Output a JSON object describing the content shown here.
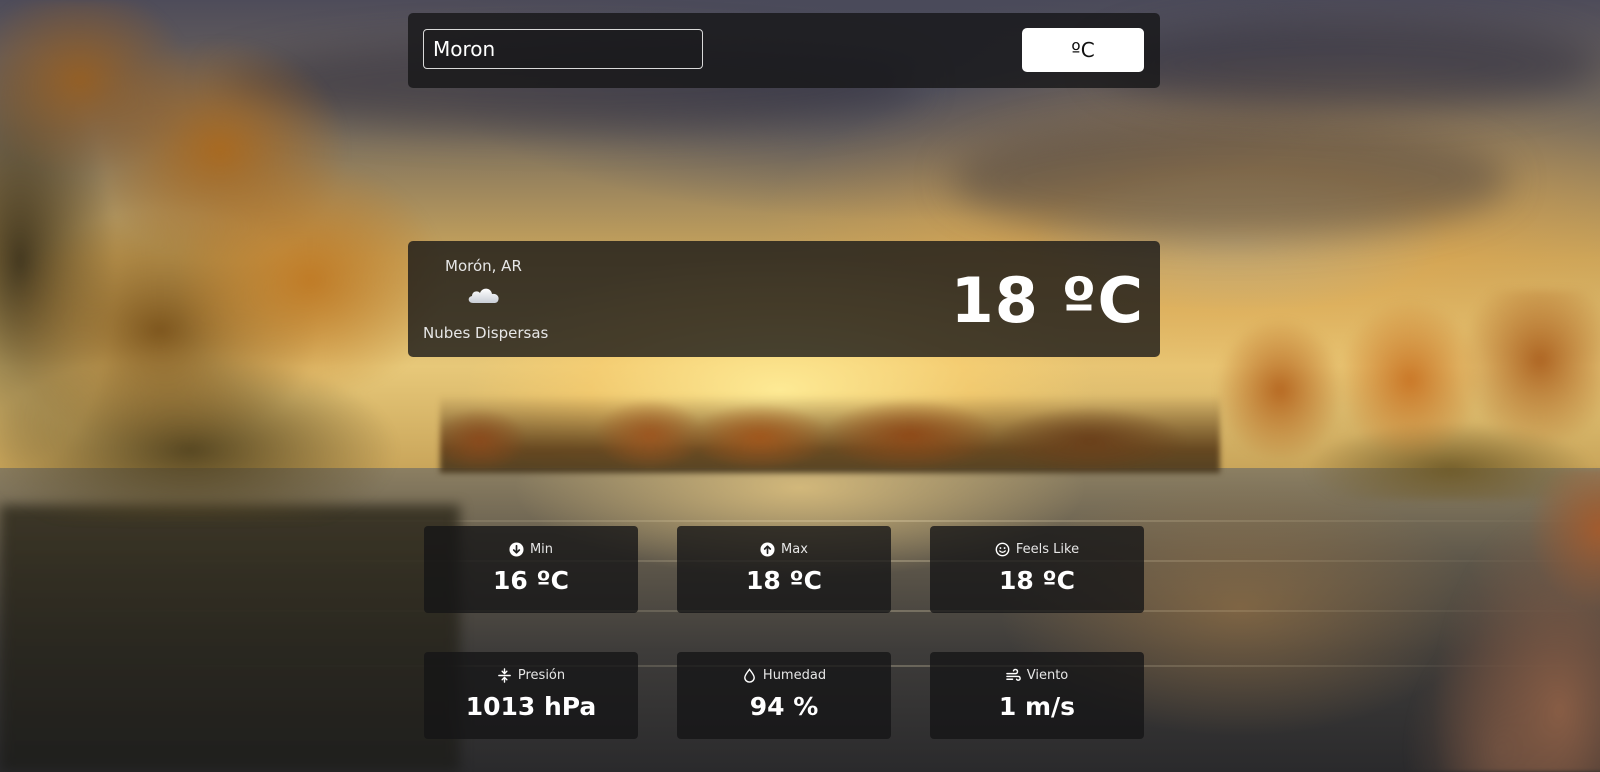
{
  "search": {
    "value": "Moron"
  },
  "unit_toggle": {
    "label": "ºC"
  },
  "current": {
    "location": "Morón, AR",
    "icon": "cloud-icon",
    "description": "Nubes Dispersas",
    "temperature": "18 ºC"
  },
  "stats": {
    "min": {
      "icon": "arrow-down-circle-icon",
      "label": "Min",
      "value": "16 ºC"
    },
    "max": {
      "icon": "arrow-up-circle-icon",
      "label": "Max",
      "value": "18 ºC"
    },
    "feels_like": {
      "icon": "smiley-icon",
      "label": "Feels Like",
      "value": "18 ºC"
    },
    "pressure": {
      "icon": "compress-icon",
      "label": "Presión",
      "value": "1013 hPa"
    },
    "humidity": {
      "icon": "droplet-icon",
      "label": "Humedad",
      "value": "94 %"
    },
    "wind": {
      "icon": "wind-icon",
      "label": "Viento",
      "value": "1 m/s"
    }
  }
}
